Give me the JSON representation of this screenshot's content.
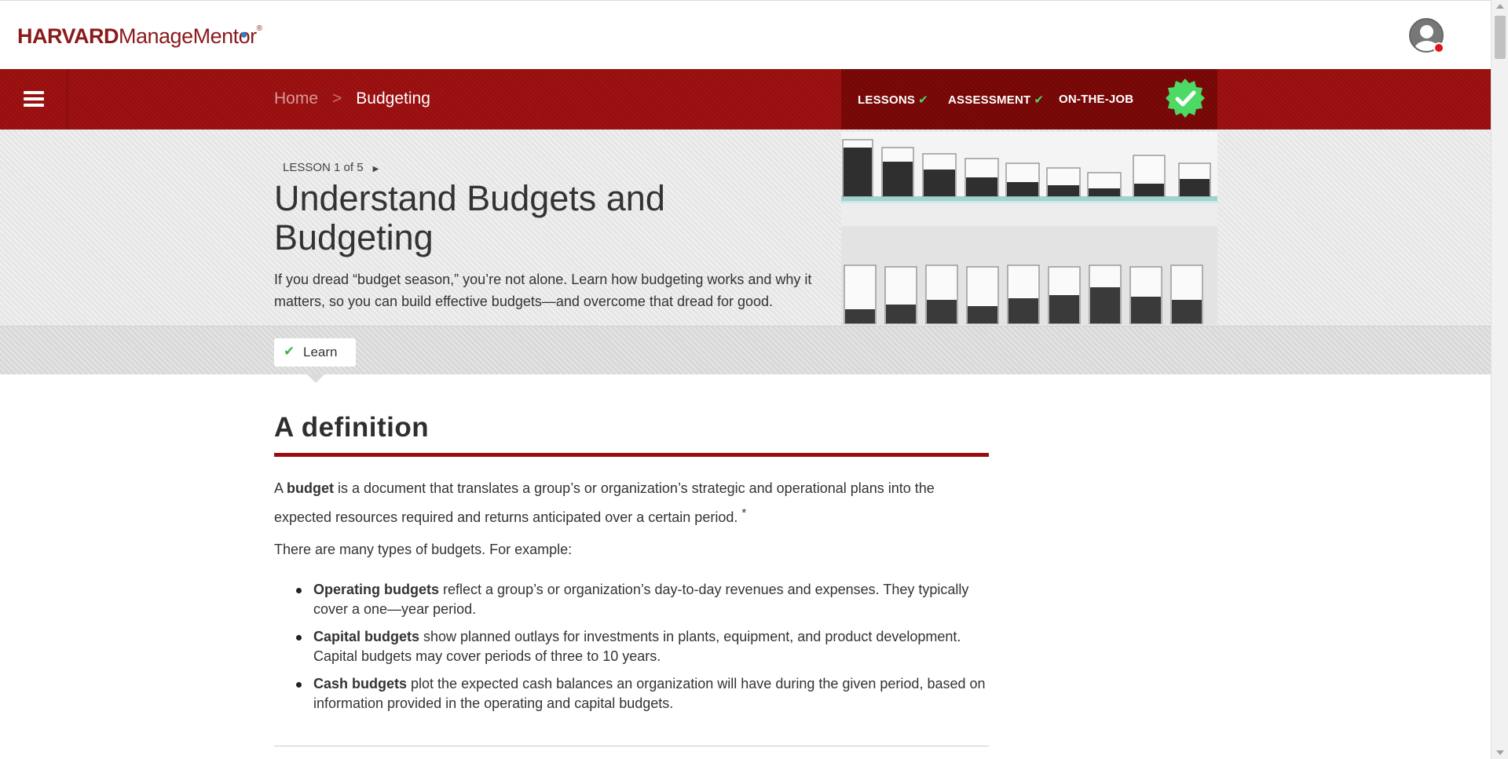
{
  "brand": {
    "name_bold": "HARVARD",
    "name_rest": "ManageMent",
    "name_end": "r",
    "reg": "®"
  },
  "breadcrumb": {
    "home": "Home",
    "separator": ">",
    "current": "Budgeting"
  },
  "progress_nav": {
    "items": [
      {
        "label": "LESSONS",
        "completed": true
      },
      {
        "label": "ASSESSMENT",
        "completed": true
      },
      {
        "label": "ON-THE-JOB",
        "completed": false
      }
    ],
    "badge_icon": "verified-check-badge",
    "check_color": "#4cd964"
  },
  "lesson": {
    "meta": "LESSON 1 of 5",
    "title": "Understand Budgets and Budgeting",
    "description": "If you dread “budget season,” you’re not alone. Learn how budgeting works and why it matters, so you can build effective budgets—and overcome that dread for good."
  },
  "tabs": [
    {
      "label": "Learn",
      "completed": true
    }
  ],
  "content": {
    "heading": "A definition",
    "definition": {
      "prefix": "A ",
      "term": "budget",
      "text": " is a document that translates a group’s or organization’s strategic and operational plans into the expected resources required and returns anticipated over a certain period.",
      "footnote": "*"
    },
    "intro": "There are many types of budgets. For example:",
    "types": [
      {
        "term": "Operating budgets",
        "text": " reflect a group’s or organization’s day-to-day revenues and expenses. They typically cover a one—year period."
      },
      {
        "term": "Capital budgets",
        "text": " show planned outlays for investments in plants, equipment, and product development. Capital budgets may cover periods of three to 10 years."
      },
      {
        "term": "Cash budgets",
        "text": " plot the expected cash balances an organization will have during the given period, based on information provided in the operating and capital budgets."
      }
    ]
  },
  "colors": {
    "brand_red": "#9b0d0d",
    "dark_red": "#7a0606",
    "success_green": "#3bb54a"
  }
}
